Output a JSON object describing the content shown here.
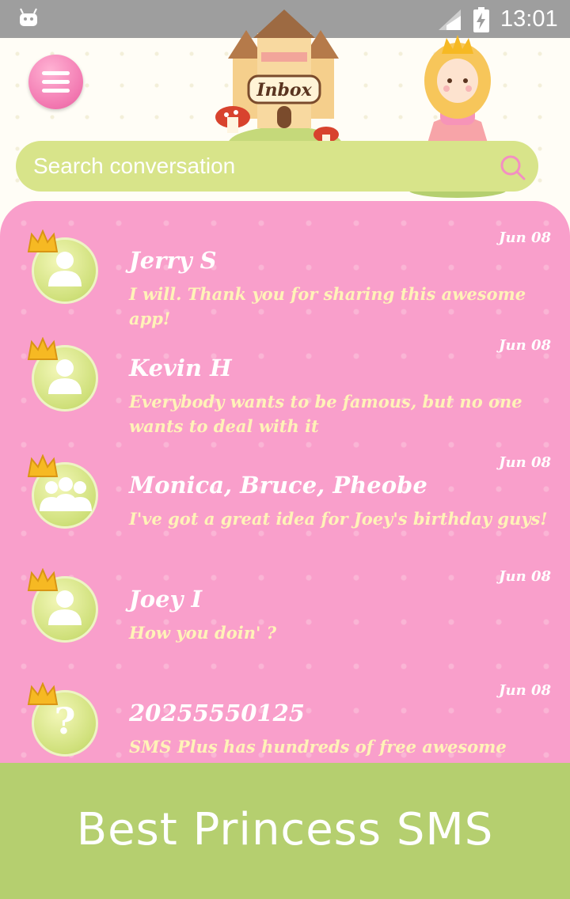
{
  "status_bar": {
    "time": "13:01"
  },
  "header": {
    "castle_label": "Inbox",
    "search": {
      "placeholder": "Search conversation"
    }
  },
  "conversations": [
    {
      "name": "Jerry S",
      "preview": "I will. Thank you for sharing this awesome app!",
      "date": "Jun 08",
      "avatar": "person-icon"
    },
    {
      "name": "Kevin H",
      "preview": "Everybody wants to be famous, but no one wants to deal with it",
      "date": "Jun 08",
      "avatar": "person-icon"
    },
    {
      "name": "Monica, Bruce, Pheobe",
      "preview": "I've got a great idea for Joey's birthday guys!",
      "date": "Jun 08",
      "avatar": "group-icon"
    },
    {
      "name": "Joey I",
      "preview": "How you doin' ?",
      "date": "Jun 08",
      "avatar": "person-icon"
    },
    {
      "name": "20255550125",
      "preview": "SMS Plus has hundreds of free awesome themes",
      "date": "Jun 08",
      "avatar": "question-icon"
    }
  ],
  "footer": {
    "title": "Best Princess SMS"
  },
  "colors": {
    "status_bar": "#9e9e9e",
    "panel": "#f99fcb",
    "search_bar": "#d8e48a",
    "footer": "#b5cf6f",
    "preview_text": "#fff3b8"
  }
}
